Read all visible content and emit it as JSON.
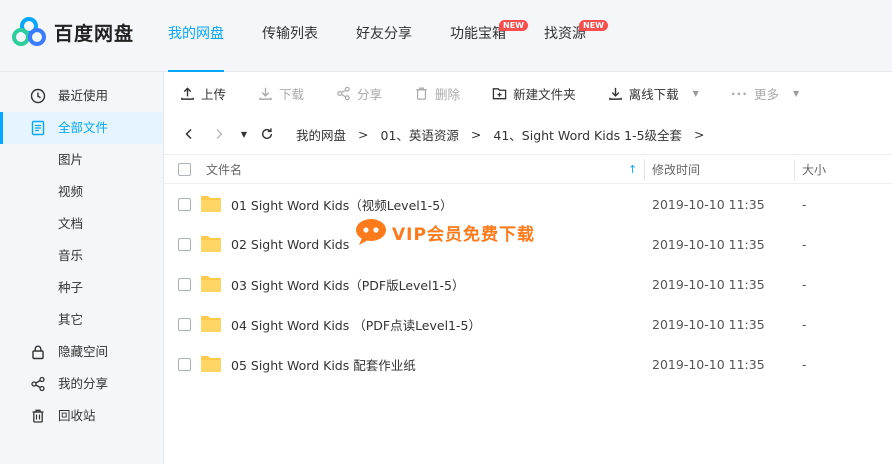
{
  "app": {
    "name": "百度网盘"
  },
  "topnav": [
    {
      "label": "我的网盘",
      "active": true,
      "badge": ""
    },
    {
      "label": "传输列表",
      "active": false,
      "badge": ""
    },
    {
      "label": "好友分享",
      "active": false,
      "badge": ""
    },
    {
      "label": "功能宝箱",
      "active": false,
      "badge": "NEW"
    },
    {
      "label": "找资源",
      "active": false,
      "badge": "NEW"
    }
  ],
  "sidebar": {
    "items": [
      {
        "label": "最近使用",
        "icon": "clock-icon"
      },
      {
        "label": "全部文件",
        "icon": "document-icon",
        "active": true
      },
      {
        "label": "图片"
      },
      {
        "label": "视频"
      },
      {
        "label": "文档"
      },
      {
        "label": "音乐"
      },
      {
        "label": "种子"
      },
      {
        "label": "其它"
      },
      {
        "label": "隐藏空间",
        "icon": "lock-icon"
      },
      {
        "label": "我的分享",
        "icon": "share-icon"
      },
      {
        "label": "回收站",
        "icon": "trash-icon"
      }
    ]
  },
  "toolbar": {
    "upload": "上传",
    "download": "下载",
    "share": "分享",
    "delete": "删除",
    "new_folder": "新建文件夹",
    "offline_download": "离线下载",
    "more": "更多"
  },
  "path": {
    "crumbs": [
      "我的网盘",
      "01、英语资源",
      "41、Sight Word Kids 1-5级全套"
    ]
  },
  "table": {
    "col_name": "文件名",
    "col_time": "修改时间",
    "col_size": "大小",
    "rows": [
      {
        "name": "01 Sight Word Kids（视频Level1-5）",
        "time": "2019-10-10 11:35",
        "size": "-"
      },
      {
        "name": "02 Sight Word Kids",
        "time": "2019-10-10 11:35",
        "size": "-"
      },
      {
        "name": "03 Sight Word Kids（PDF版Level1-5）",
        "time": "2019-10-10 11:35",
        "size": "-"
      },
      {
        "name": "04 Sight Word Kids （PDF点读Level1-5）",
        "time": "2019-10-10 11:35",
        "size": "-"
      },
      {
        "name": "05 Sight Word Kids 配套作业纸",
        "time": "2019-10-10 11:35",
        "size": "-"
      }
    ]
  },
  "watermark": {
    "text": "VIP会员免费下载"
  },
  "colors": {
    "accent": "#06a7ff",
    "badge": "#fa4d4d",
    "folder": "#ffc94a",
    "watermark": "#ff7a1a"
  }
}
